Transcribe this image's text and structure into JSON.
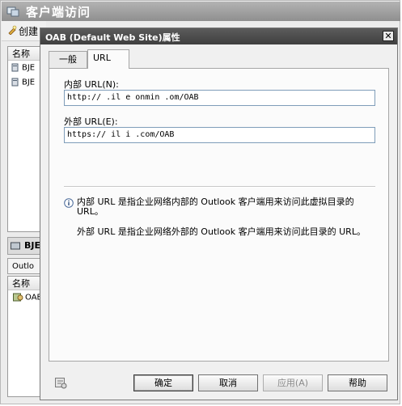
{
  "background_window": {
    "title": "客户端访问",
    "toolbar_create": "创建",
    "list_header": "名称",
    "list_items": [
      "BJE",
      "BJE"
    ],
    "section_title": "BJE",
    "tab_label": "Outlo",
    "list2_header": "名称",
    "list2_item": "OAB"
  },
  "dialog": {
    "title": "OAB (Default Web Site)属性",
    "tabs": [
      "一般",
      "URL"
    ],
    "active_tab": "URL",
    "internal_url_label": "内部 URL(N):",
    "internal_url_value": "http://  .il   e  onmin   .om/OAB",
    "external_url_label": "外部 URL(E):",
    "external_url_value": "https://  il            i  .com/OAB",
    "info_internal": "内部 URL 是指企业网络内部的 Outlook 客户端用来访问此虚拟目录的 URL。",
    "info_external": "外部 URL 是指企业网络外部的 Outlook 客户端用来访问此目录的 URL。",
    "buttons": {
      "ok": "确定",
      "cancel": "取消",
      "apply": "应用(A)",
      "help": "帮助"
    }
  },
  "colors": {
    "dialog_title_bg": "#4a4a4a",
    "window_bg": "#f0f0f0",
    "field_border": "#7f9db9"
  }
}
